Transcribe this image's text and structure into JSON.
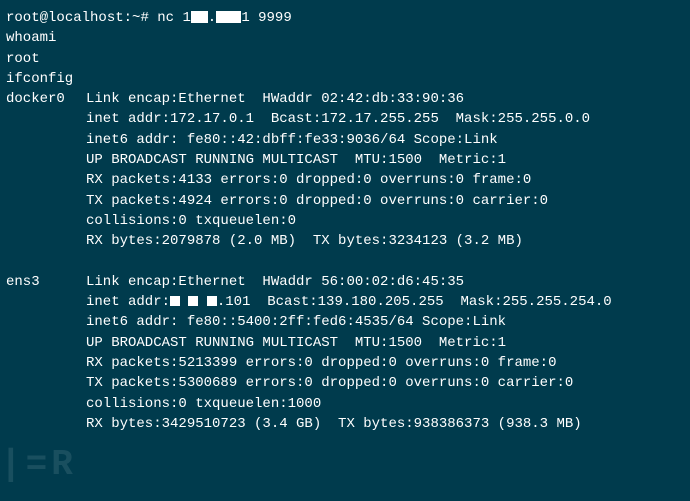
{
  "prompt": {
    "user": "root",
    "host": "localhost",
    "path": "~",
    "symbol": "#",
    "cmd_prefix": "nc 1",
    "cmd_redacted_a": "   ",
    "cmd_mid": ".",
    "cmd_redacted_b": "   ",
    "cmd_suffix": "1 9999"
  },
  "cmd1": "whoami",
  "out1": "root",
  "cmd2": "ifconfig",
  "docker": {
    "name": "docker0",
    "l1": "Link encap:Ethernet  HWaddr 02:42:db:33:90:36",
    "l2": "inet addr:172.17.0.1  Bcast:172.17.255.255  Mask:255.255.0.0",
    "l3": "inet6 addr: fe80::42:dbff:fe33:9036/64 Scope:Link",
    "l4": "UP BROADCAST RUNNING MULTICAST  MTU:1500  Metric:1",
    "l5": "RX packets:4133 errors:0 dropped:0 overruns:0 frame:0",
    "l6": "TX packets:4924 errors:0 dropped:0 overruns:0 carrier:0",
    "l7": "collisions:0 txqueuelen:0",
    "l8": "RX bytes:2079878 (2.0 MB)  TX bytes:3234123 (3.2 MB)"
  },
  "ens3": {
    "name": "ens3",
    "l1": "Link encap:Ethernet  HWaddr 56:00:02:d6:45:35",
    "l2a": "inet addr:",
    "l2b": ".101  Bcast:139.180.205.255  Mask:255.255.254.0",
    "l3": "inet6 addr: fe80::5400:2ff:fed6:4535/64 Scope:Link",
    "l4": "UP BROADCAST RUNNING MULTICAST  MTU:1500  Metric:1",
    "l5": "RX packets:5213399 errors:0 dropped:0 overruns:0 frame:0",
    "l6": "TX packets:5300689 errors:0 dropped:0 overruns:0 carrier:0",
    "l7": "collisions:0 txqueuelen:1000",
    "l8": "RX bytes:3429510723 (3.4 GB)  TX bytes:938386373 (938.3 MB)"
  },
  "watermark": "|=R"
}
